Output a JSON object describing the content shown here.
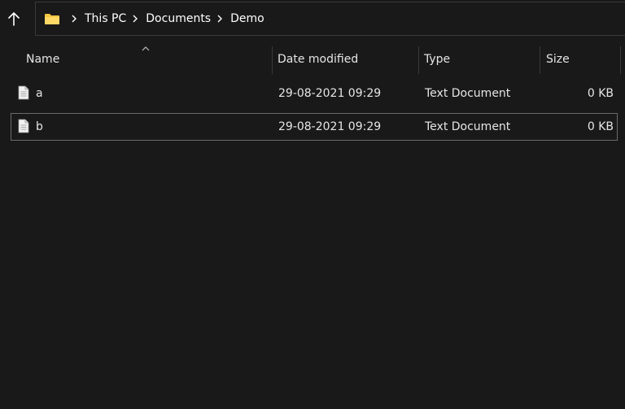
{
  "breadcrumb": {
    "items": [
      "This PC",
      "Documents",
      "Demo"
    ]
  },
  "columns": {
    "name": "Name",
    "date_modified": "Date modified",
    "type": "Type",
    "size": "Size",
    "sorted_by": "name",
    "sort_direction": "ascending"
  },
  "files": [
    {
      "name": "a",
      "date_modified": "29-08-2021 09:29",
      "type": "Text Document",
      "size": "0 KB",
      "focused": false
    },
    {
      "name": "b",
      "date_modified": "29-08-2021 09:29",
      "type": "Text Document",
      "size": "0 KB",
      "focused": true
    }
  ],
  "icons": {
    "up": "arrow-up-icon",
    "folder": "folder-icon",
    "separator": "chevron-right-icon",
    "file": "text-file-icon",
    "sort": "sort-ascending-icon"
  },
  "colors": {
    "background": "#191919",
    "text": "#e6e6e6",
    "folder": "#f4c542",
    "border": "#3a3a3a",
    "focus_border": "#6b6b6b"
  }
}
